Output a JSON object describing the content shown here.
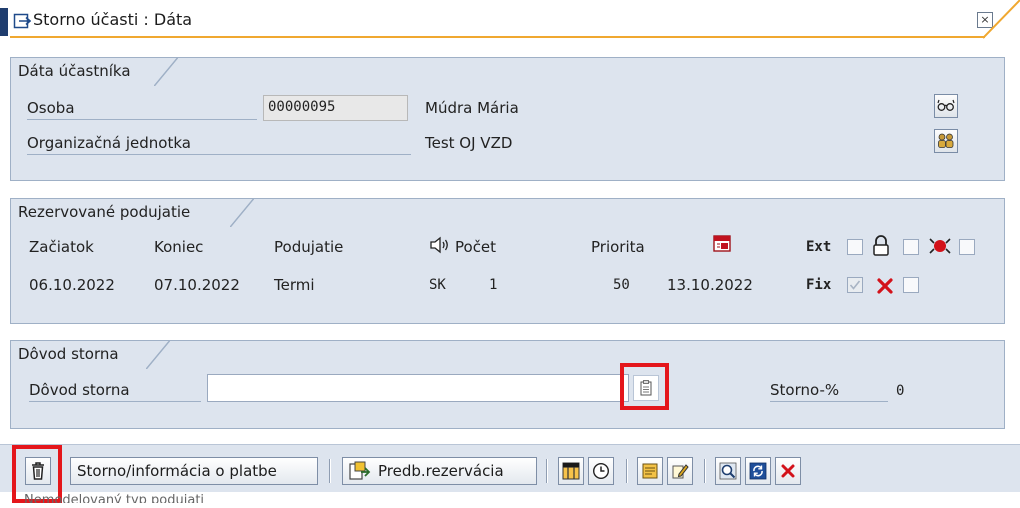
{
  "window": {
    "title": "Storno účasti : Dáta",
    "close_label": "×"
  },
  "participant": {
    "group_title": "Dáta účastníka",
    "person_label": "Osoba",
    "person_id": "00000095",
    "person_name": "Múdra Mária",
    "org_label": "Organizačná jednotka",
    "org_value": "Test OJ VZD"
  },
  "booked": {
    "group_title": "Rezervované podujatie",
    "headers": {
      "start": "Začiatok",
      "end": "Koniec",
      "event": "Podujatie",
      "count": "Počet",
      "priority": "Priorita",
      "ext": "Ext",
      "fix": "Fix"
    },
    "row": {
      "start": "06.10.2022",
      "end": "07.10.2022",
      "event": "Termi",
      "language": "SK",
      "count": "1",
      "priority": "50",
      "date": "13.10.2022"
    },
    "fix_checked": true
  },
  "reason": {
    "group_title": "Dôvod storna",
    "label": "Dôvod storna",
    "value": "",
    "storno_pct_label": "Storno-%",
    "storno_pct_value": "0"
  },
  "toolbar": {
    "storno_info_label": "Storno/informácia o platbe",
    "prebook_label": "Predb.rezervácia"
  },
  "status_bar": {
    "text": "Nemodelovaný typ podujati"
  },
  "colors": {
    "highlight": "#e4161b",
    "panel_bg": "#dde4ee",
    "accent_line": "#f0a830"
  }
}
